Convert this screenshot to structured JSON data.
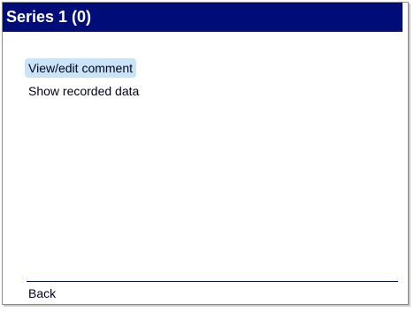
{
  "window": {
    "title": "Series 1 (0)"
  },
  "menu": {
    "items": [
      {
        "label": "View/edit comment",
        "selected": true
      },
      {
        "label": "Show recorded data",
        "selected": false
      }
    ]
  },
  "footer": {
    "back_label": "Back"
  },
  "colors": {
    "titlebar": "#000c78",
    "selection": "#c9e4f6",
    "divider": "#000c78"
  }
}
